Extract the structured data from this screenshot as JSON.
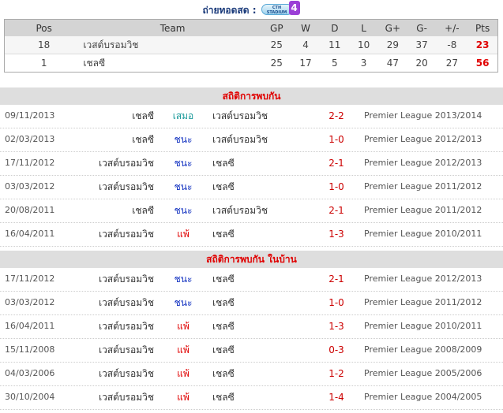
{
  "broadcast": {
    "label": "ถ่ายทอดสด :",
    "channel_text": "CTH STADIUM",
    "channel_number": "4"
  },
  "standings": {
    "headers": [
      "Pos",
      "Team",
      "GP",
      "W",
      "D",
      "L",
      "G+",
      "G-",
      "+/-",
      "Pts"
    ],
    "rows": [
      [
        "18",
        "เวสต์บรอมวิช",
        "25",
        "4",
        "11",
        "10",
        "29",
        "37",
        "-8",
        "23"
      ],
      [
        "1",
        "เชลซี",
        "25",
        "17",
        "5",
        "3",
        "47",
        "20",
        "27",
        "56"
      ]
    ]
  },
  "h2h": {
    "title": "สถิติการพบกัน",
    "matches": [
      {
        "date": "09/11/2013",
        "home": "เชลซี",
        "result": "เสมอ",
        "away": "เวสต์บรอมวิช",
        "score": "2-2",
        "competition": "Premier League 2013/2014"
      },
      {
        "date": "02/03/2013",
        "home": "เชลซี",
        "result": "ชนะ",
        "away": "เวสต์บรอมวิช",
        "score": "1-0",
        "competition": "Premier League 2012/2013"
      },
      {
        "date": "17/11/2012",
        "home": "เวสต์บรอมวิช",
        "result": "ชนะ",
        "away": "เชลซี",
        "score": "2-1",
        "competition": "Premier League 2012/2013"
      },
      {
        "date": "03/03/2012",
        "home": "เวสต์บรอมวิช",
        "result": "ชนะ",
        "away": "เชลซี",
        "score": "1-0",
        "competition": "Premier League 2011/2012"
      },
      {
        "date": "20/08/2011",
        "home": "เชลซี",
        "result": "ชนะ",
        "away": "เวสต์บรอมวิช",
        "score": "2-1",
        "competition": "Premier League 2011/2012"
      },
      {
        "date": "16/04/2011",
        "home": "เวสต์บรอมวิช",
        "result": "แพ้",
        "away": "เชลซี",
        "score": "1-3",
        "competition": "Premier League 2010/2011"
      }
    ]
  },
  "h2h_home": {
    "title": "สถิติการพบกัน ในบ้าน",
    "matches": [
      {
        "date": "17/11/2012",
        "home": "เวสต์บรอมวิช",
        "result": "ชนะ",
        "away": "เชลซี",
        "score": "2-1",
        "competition": "Premier League 2012/2013"
      },
      {
        "date": "03/03/2012",
        "home": "เวสต์บรอมวิช",
        "result": "ชนะ",
        "away": "เชลซี",
        "score": "1-0",
        "competition": "Premier League 2011/2012"
      },
      {
        "date": "16/04/2011",
        "home": "เวสต์บรอมวิช",
        "result": "แพ้",
        "away": "เชลซี",
        "score": "1-3",
        "competition": "Premier League 2010/2011"
      },
      {
        "date": "15/11/2008",
        "home": "เวสต์บรอมวิช",
        "result": "แพ้",
        "away": "เชลซี",
        "score": "0-3",
        "competition": "Premier League 2008/2009"
      },
      {
        "date": "04/03/2006",
        "home": "เวสต์บรอมวิช",
        "result": "แพ้",
        "away": "เชลซี",
        "score": "1-2",
        "competition": "Premier League 2005/2006"
      },
      {
        "date": "30/10/2004",
        "home": "เวสต์บรอมวิช",
        "result": "แพ้",
        "away": "เชลซี",
        "score": "1-4",
        "competition": "Premier League 2004/2005"
      }
    ]
  },
  "colors": {
    "accent_red": "#e00000",
    "draw": "#1a9a9a",
    "win": "#1030c0",
    "loss": "#e00000"
  }
}
